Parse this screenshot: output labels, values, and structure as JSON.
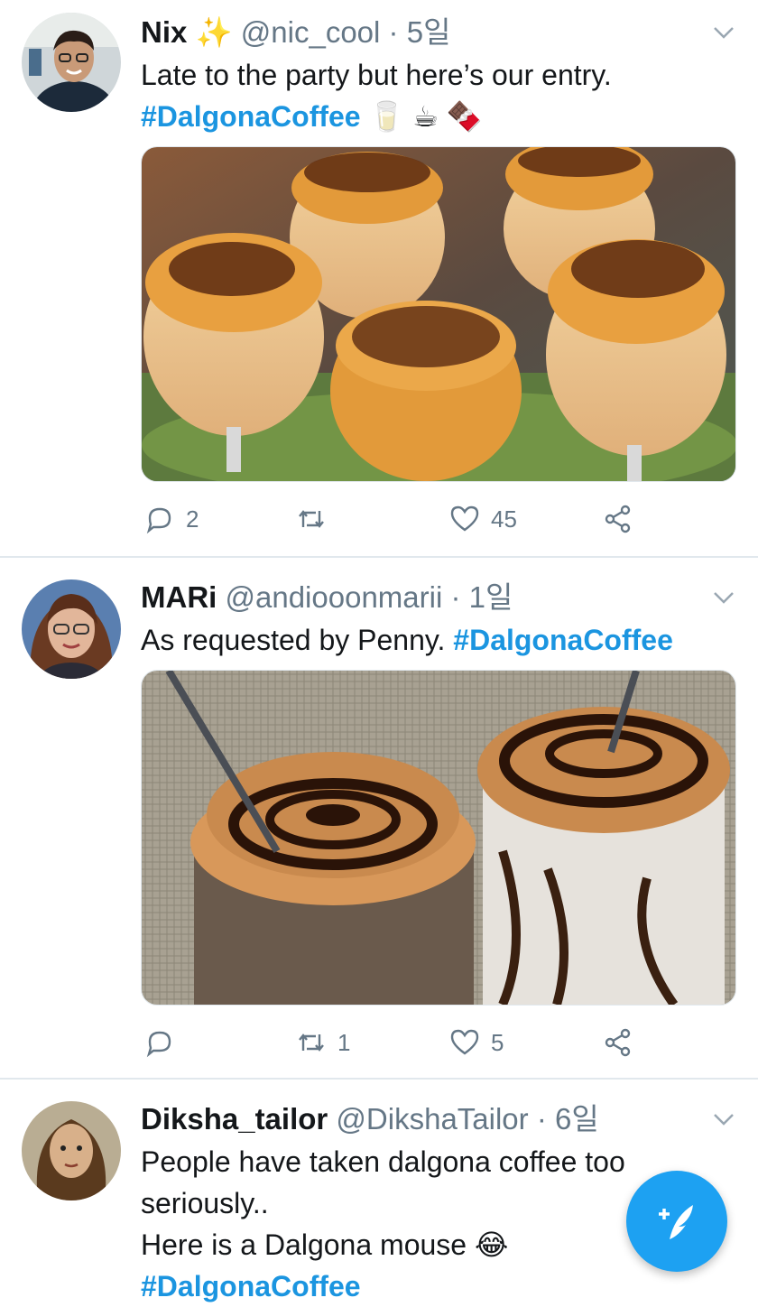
{
  "tweets": [
    {
      "name": "Nix",
      "name_emoji": "✨",
      "handle": "@nic_cool",
      "age": "5일",
      "text": "Late to the party but here’s our entry.",
      "hashtag": "#DalgonaCoffee",
      "tag_emojis": [
        "🥛",
        "☕",
        "🍫"
      ],
      "replies": "2",
      "retweets": "",
      "likes": "45"
    },
    {
      "name": "MARi",
      "handle": "@andiooonmarii",
      "age": "1일",
      "text": "As requested by Penny.",
      "hashtag": "#DalgonaCoffee",
      "replies": "",
      "retweets": "1",
      "likes": "5"
    },
    {
      "name": "Diksha_tailor",
      "handle": "@DikshaTailor",
      "age": "6일",
      "text_line1": "People have taken dalgona coffee too seriously..",
      "text_line2": "Here is a Dalgona mouse",
      "text_emoji": "😂",
      "hashtag": "#DalgonaCoffee"
    }
  ],
  "separator": "·",
  "icons": {
    "reply": "reply-icon",
    "retweet": "retweet-icon",
    "like": "heart-icon",
    "share": "share-icon",
    "caret": "chevron-down-icon",
    "compose": "compose-tweet-icon"
  },
  "colors": {
    "accent": "#1da1f2",
    "hashtag": "#1b95e0",
    "secondary_text": "#657786",
    "divider": "#e1e8ed"
  }
}
